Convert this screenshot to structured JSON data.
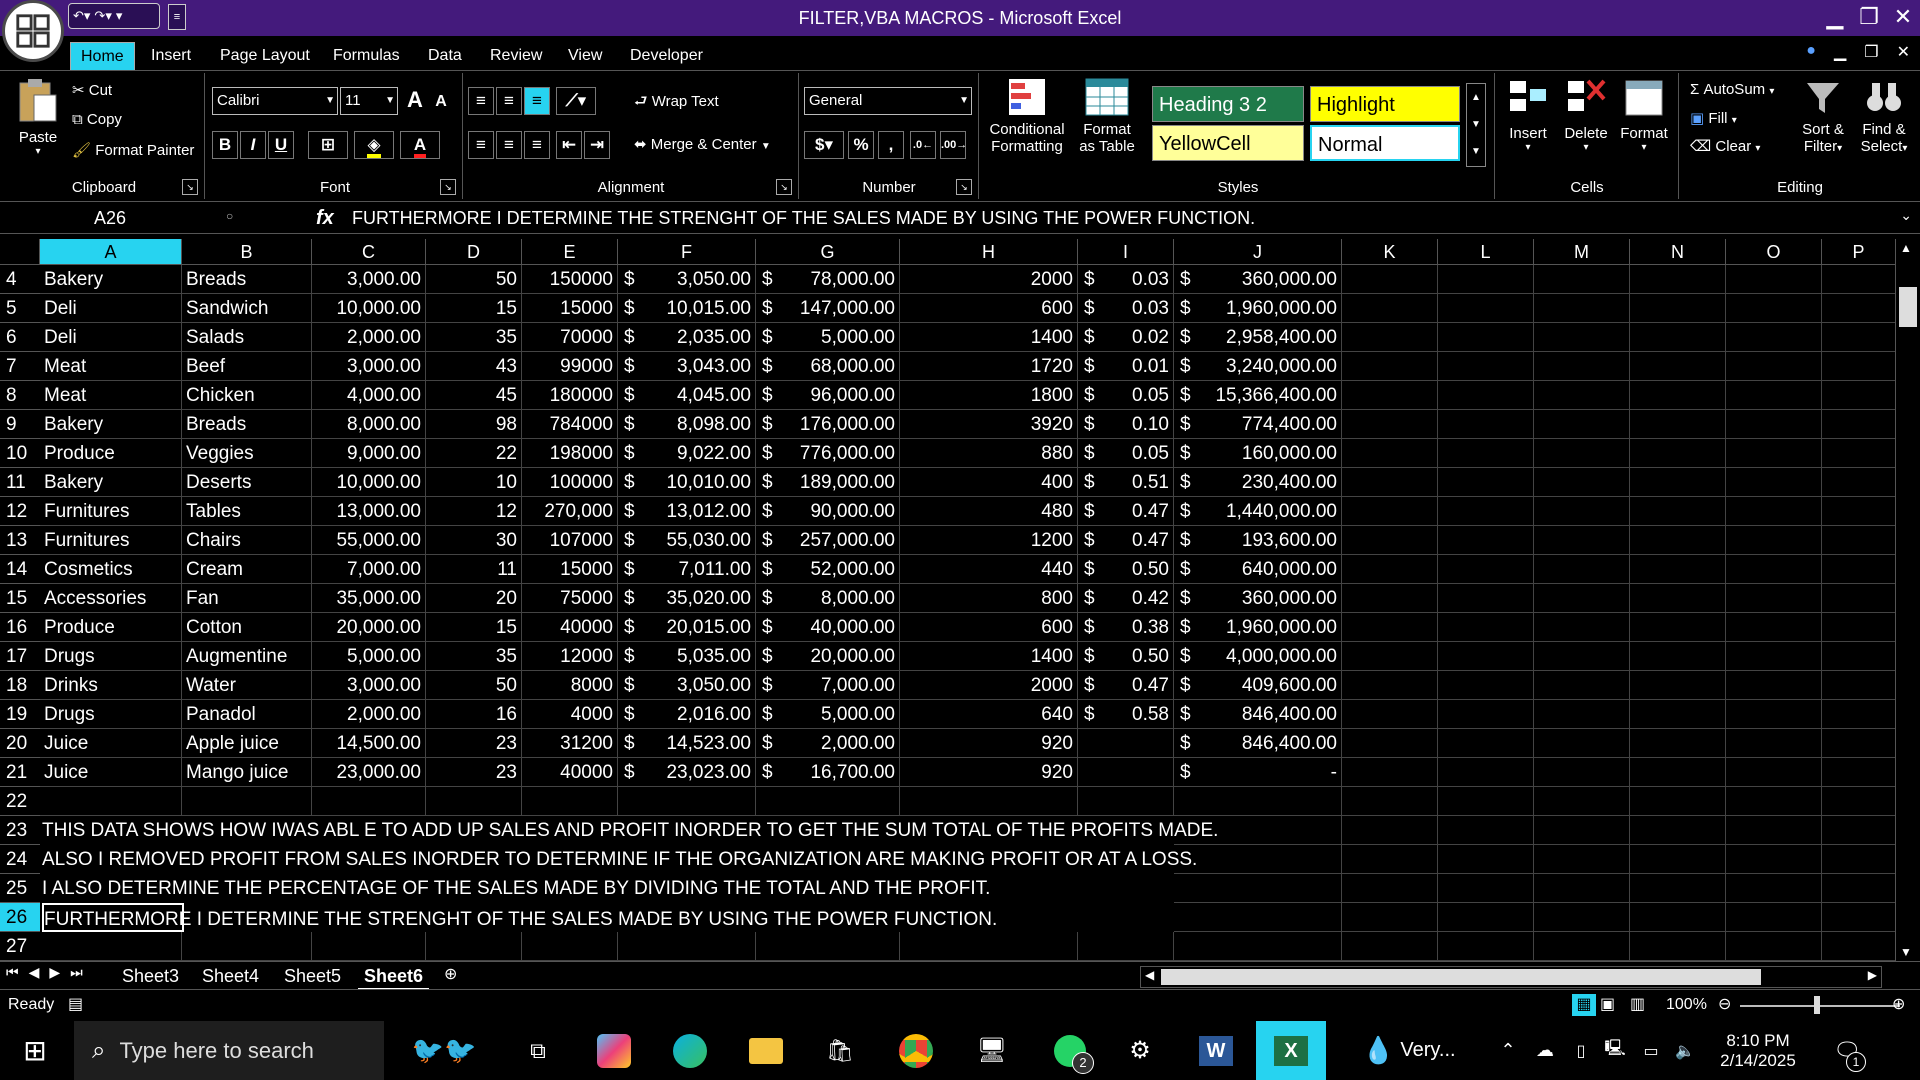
{
  "window": {
    "title": "FILTER,VBA MACROS - Microsoft Excel"
  },
  "tabs": [
    "Home",
    "Insert",
    "Page Layout",
    "Formulas",
    "Data",
    "Review",
    "View",
    "Developer"
  ],
  "ribbon": {
    "clipboard": {
      "label": "Clipboard",
      "paste": "Paste",
      "cut": "Cut",
      "copy": "Copy",
      "format_painter": "Format Painter"
    },
    "font": {
      "label": "Font",
      "name": "Calibri",
      "size": "11"
    },
    "alignment": {
      "label": "Alignment",
      "wrap": "Wrap Text",
      "merge": "Merge & Center"
    },
    "number": {
      "label": "Number",
      "format": "General"
    },
    "styles": {
      "label": "Styles",
      "conditional_1": "Conditional",
      "conditional_2": "Formatting",
      "format_table_1": "Format",
      "format_table_2": "as Table",
      "heading": "Heading 3 2",
      "highlight": "Highlight",
      "yellowcell": "YellowCell",
      "normal": "Normal"
    },
    "cells": {
      "label": "Cells",
      "insert": "Insert",
      "delete": "Delete",
      "format": "Format"
    },
    "editing": {
      "label": "Editing",
      "autosum": "AutoSum",
      "fill": "Fill",
      "clear": "Clear",
      "sort_1": "Sort &",
      "sort_2": "Filter",
      "find_1": "Find &",
      "find_2": "Select"
    }
  },
  "formula_bar": {
    "name_box": "A26",
    "fx": "fx",
    "content": "FURTHERMORE I DETERMINE THE STRENGHT OF THE SALES MADE BY USING THE POWER FUNCTION."
  },
  "columns": [
    "A",
    "B",
    "C",
    "D",
    "E",
    "F",
    "G",
    "H",
    "I",
    "J",
    "K",
    "L",
    "M",
    "N",
    "O",
    "P"
  ],
  "rows": [
    {
      "n": "4",
      "a": "Bakery",
      "b": "Breads",
      "c": "3,000.00",
      "d": "50",
      "e": "150000",
      "f": "3,050.00",
      "g": "78,000.00",
      "h": "2000",
      "i": "0.03",
      "j": "360,000.00"
    },
    {
      "n": "5",
      "a": "Deli",
      "b": "Sandwich",
      "c": "10,000.00",
      "d": "15",
      "e": "15000",
      "f": "10,015.00",
      "g": "147,000.00",
      "h": "600",
      "i": "0.03",
      "j": "1,960,000.00"
    },
    {
      "n": "6",
      "a": "Deli",
      "b": "Salads",
      "c": "2,000.00",
      "d": "35",
      "e": "70000",
      "f": "2,035.00",
      "g": "5,000.00",
      "h": "1400",
      "i": "0.02",
      "j": "2,958,400.00"
    },
    {
      "n": "7",
      "a": "Meat",
      "b": "Beef",
      "c": "3,000.00",
      "d": "43",
      "e": "99000",
      "f": "3,043.00",
      "g": "68,000.00",
      "h": "1720",
      "i": "0.01",
      "j": "3,240,000.00"
    },
    {
      "n": "8",
      "a": "Meat",
      "b": "Chicken",
      "c": "4,000.00",
      "d": "45",
      "e": "180000",
      "f": "4,045.00",
      "g": "96,000.00",
      "h": "1800",
      "i": "0.05",
      "j": "15,366,400.00"
    },
    {
      "n": "9",
      "a": "Bakery",
      "b": "Breads",
      "c": "8,000.00",
      "d": "98",
      "e": "784000",
      "f": "8,098.00",
      "g": "176,000.00",
      "h": "3920",
      "i": "0.10",
      "j": "774,400.00"
    },
    {
      "n": "10",
      "a": "Produce",
      "b": "Veggies",
      "c": "9,000.00",
      "d": "22",
      "e": "198000",
      "f": "9,022.00",
      "g": "776,000.00",
      "h": "880",
      "i": "0.05",
      "j": "160,000.00"
    },
    {
      "n": "11",
      "a": "Bakery",
      "b": "Deserts",
      "c": "10,000.00",
      "d": "10",
      "e": "100000",
      "f": "10,010.00",
      "g": "189,000.00",
      "h": "400",
      "i": "0.51",
      "j": "230,400.00"
    },
    {
      "n": "12",
      "a": "Furnitures",
      "b": "Tables",
      "c": "13,000.00",
      "d": "12",
      "e": "270,000",
      "f": "13,012.00",
      "g": "90,000.00",
      "h": "480",
      "i": "0.47",
      "j": "1,440,000.00"
    },
    {
      "n": "13",
      "a": "Furnitures",
      "b": "Chairs",
      "c": "55,000.00",
      "d": "30",
      "e": "107000",
      "f": "55,030.00",
      "g": "257,000.00",
      "h": "1200",
      "i": "0.47",
      "j": "193,600.00"
    },
    {
      "n": "14",
      "a": "Cosmetics",
      "b": "Cream",
      "c": "7,000.00",
      "d": "11",
      "e": "15000",
      "f": "7,011.00",
      "g": "52,000.00",
      "h": "440",
      "i": "0.50",
      "j": "640,000.00"
    },
    {
      "n": "15",
      "a": "Accessories",
      "b": "Fan",
      "c": "35,000.00",
      "d": "20",
      "e": "75000",
      "f": "35,020.00",
      "g": "8,000.00",
      "h": "800",
      "i": "0.42",
      "j": "360,000.00"
    },
    {
      "n": "16",
      "a": "Produce",
      "b": "Cotton",
      "c": "20,000.00",
      "d": "15",
      "e": "40000",
      "f": "20,015.00",
      "g": "40,000.00",
      "h": "600",
      "i": "0.38",
      "j": "1,960,000.00"
    },
    {
      "n": "17",
      "a": "Drugs",
      "b": "Augmentine",
      "c": "5,000.00",
      "d": "35",
      "e": "12000",
      "f": "5,035.00",
      "g": "20,000.00",
      "h": "1400",
      "i": "0.50",
      "j": "4,000,000.00"
    },
    {
      "n": "18",
      "a": "Drinks",
      "b": "Water",
      "c": "3,000.00",
      "d": "50",
      "e": "8000",
      "f": "3,050.00",
      "g": "7,000.00",
      "h": "2000",
      "i": "0.47",
      "j": "409,600.00"
    },
    {
      "n": "19",
      "a": "Drugs",
      "b": "Panadol",
      "c": "2,000.00",
      "d": "16",
      "e": "4000",
      "f": "2,016.00",
      "g": "5,000.00",
      "h": "640",
      "i": "0.58",
      "j": "846,400.00"
    },
    {
      "n": "20",
      "a": "Juice",
      "b": "Apple juice",
      "c": "14,500.00",
      "d": "23",
      "e": "31200",
      "f": "14,523.00",
      "g": "2,000.00",
      "h": "920",
      "i": "",
      "j": "846,400.00"
    },
    {
      "n": "21",
      "a": "Juice",
      "b": "Mango juice",
      "c": "23,000.00",
      "d": "23",
      "e": "40000",
      "f": "23,023.00",
      "g": "16,700.00",
      "h": "920",
      "i": "",
      "j": "-"
    }
  ],
  "empty_rows": [
    "22",
    "27"
  ],
  "notes": [
    {
      "n": "23",
      "text": "THIS DATA SHOWS HOW IWAS ABL E TO ADD UP SALES AND PROFIT INORDER TO GET THE SUM TOTAL OF THE PROFITS MADE."
    },
    {
      "n": "24",
      "text": "ALSO I REMOVED PROFIT FROM SALES INORDER TO DETERMINE IF THE ORGANIZATION ARE MAKING  PROFIT OR AT A LOSS."
    },
    {
      "n": "25",
      "text": "I ALSO DETERMINE THE PERCENTAGE OF THE SALES MADE BY DIVIDING THE TOTAL AND THE PROFIT."
    },
    {
      "n": "26",
      "text": "FURTHERMORE I DETERMINE THE STRENGHT OF THE SALES MADE BY USING THE POWER FUNCTION."
    }
  ],
  "currency_symbol": "$",
  "sheets": [
    "Sheet3",
    "Sheet4",
    "Sheet5",
    "Sheet6"
  ],
  "active_sheet": "Sheet6",
  "status": {
    "ready": "Ready",
    "zoom": "100%"
  },
  "taskbar": {
    "search_placeholder": "Type here to search",
    "whatsapp_badge": "2",
    "weather": "Very...",
    "time": "8:10 PM",
    "date": "2/14/2025",
    "notif_count": "1"
  },
  "colors": {
    "accent": "#27d3f0",
    "title_bar": "#441a7c",
    "heading": "#1f7a4a",
    "highlight": "#ffff00",
    "yellowcell": "#ffff99"
  }
}
